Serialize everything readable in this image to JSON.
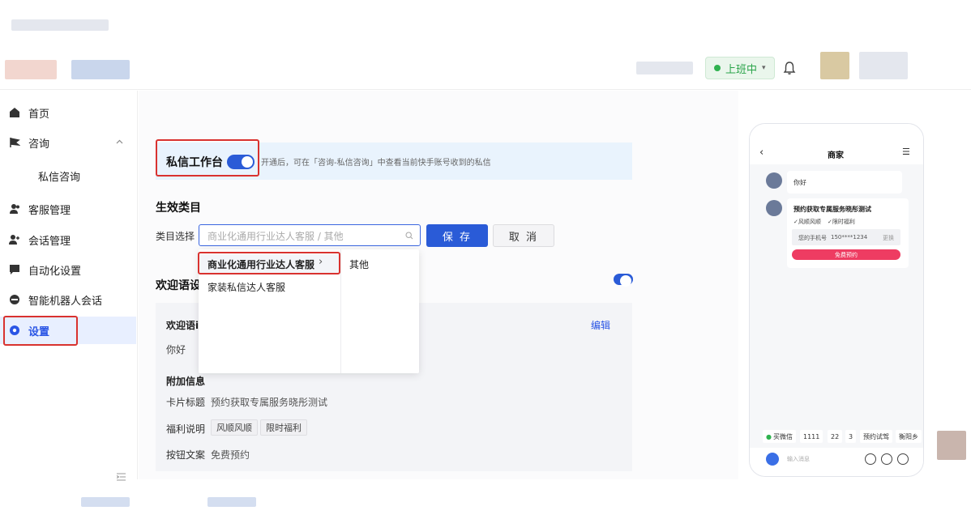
{
  "header": {
    "status_label": "上班中",
    "status_caret": "▾"
  },
  "sidebar": {
    "items": [
      {
        "label": "首页"
      },
      {
        "label": "咨询"
      },
      {
        "label": "私信咨询"
      },
      {
        "label": "客服管理"
      },
      {
        "label": "会话管理"
      },
      {
        "label": "自动化设置"
      },
      {
        "label": "智能机器人会话"
      },
      {
        "label": "设置"
      }
    ]
  },
  "main": {
    "workbench_label": "私信工作台",
    "workbench_desc": "开通后，可在「咨询-私信咨询」中查看当前快手账号收到的私信",
    "section_effective": "生效类目",
    "category_label": "类目选择",
    "category_placeholder": "商业化通用行业达人客服 / 其他",
    "save_label": "保 存",
    "cancel_label": "取 消",
    "dropdown": {
      "level1": [
        "商业化通用行业达人客服",
        "家装私信达人客服"
      ],
      "level1_arrow": "›",
      "level2": [
        "其他"
      ]
    },
    "section_welcome": "欢迎语设",
    "welcome_card": {
      "title": "欢迎语i",
      "edit_label": "编辑",
      "greeting": "你好",
      "extra_title": "附加信息",
      "card_title_label": "卡片标题",
      "card_title_value": "预约获取专属服务晓彤测试",
      "benefit_label": "福利说明",
      "benefit_tags": [
        "风顺风顺",
        "限时福利"
      ],
      "button_label": "按钮文案",
      "button_value": "免费预约"
    }
  },
  "phone": {
    "title": "商家",
    "msg1": "你好",
    "card_title": "预约获取专属服务晓彤测试",
    "card_tags": [
      "✓风顺风顺",
      "✓限时福利"
    ],
    "phone_label": "您的手机号",
    "phone_value": "150****1234",
    "change_label": "更换",
    "cta": "免费预约",
    "quick_chips": [
      "买微信",
      "1111",
      "22",
      "3",
      "预约试驾",
      "衡阳乡"
    ],
    "input_placeholder": "输入消息"
  }
}
